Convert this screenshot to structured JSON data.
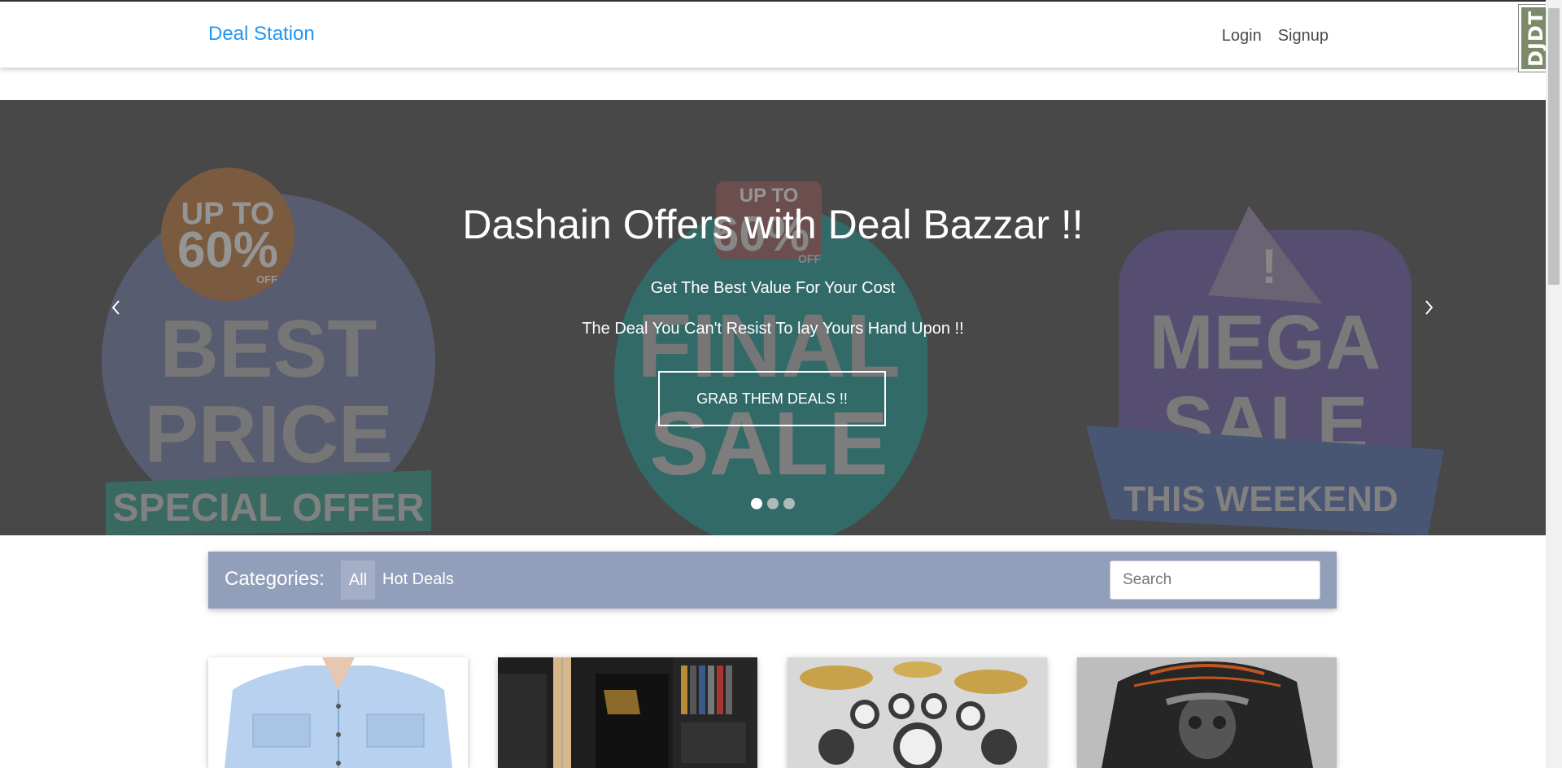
{
  "navbar": {
    "brand": "Deal Station",
    "links": [
      "Login",
      "Signup"
    ]
  },
  "debug_toolbar": {
    "label": "DJDT"
  },
  "carousel": {
    "title": "Dashain Offers with Deal Bazzar !!",
    "subtitle": "Get The Best Value For Your Cost",
    "tagline": "The Deal You Can't Resist To lay Yours Hand Upon !!",
    "button_label": "GRAB THEM DEALS !!",
    "prev_icon": "chevron-left-icon",
    "next_icon": "chevron-right-icon",
    "slide_count": 3,
    "active_slide": 1,
    "background_art": {
      "left": [
        "UP TO",
        "60%",
        "OFF",
        "BEST",
        "PRICE",
        "SPECIAL OFFER"
      ],
      "center": [
        "UP TO",
        "60%",
        "OFF",
        "FINAL",
        "SALE"
      ],
      "right": [
        "!",
        "MEGA",
        "SALE",
        "THIS WEEKEND"
      ]
    }
  },
  "categories": {
    "label": "Categories:",
    "items": [
      "All",
      "Hot Deals"
    ],
    "active": "All",
    "search_placeholder": "Search"
  },
  "products": [
    {
      "image": "denim-shirt-image"
    },
    {
      "image": "guitar-bookshelf-image"
    },
    {
      "image": "drum-kit-image"
    },
    {
      "image": "leather-jacket-image"
    }
  ],
  "colors": {
    "brand": "#2196f3",
    "carousel_bg": "#4a4a4a",
    "category_bar": "#929fba"
  }
}
